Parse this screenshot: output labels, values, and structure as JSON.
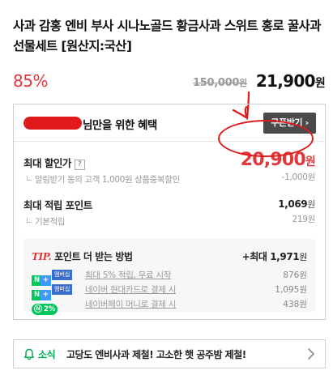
{
  "product": {
    "title": "사과 감홍 엔비 부사 시나노골드 황금사과 스위트 홍로 꿀사과 선물세트 [원산지:국산]"
  },
  "price": {
    "discount_rate": "85%",
    "original": "150,000",
    "original_unit": "원",
    "sale": "21,900",
    "sale_unit": "원"
  },
  "benefit": {
    "header_suffix": "님만을 위한 혜택",
    "coupon_button": "쿠폰받기",
    "max_discount_label": "최대 할인가",
    "max_discount_price": "20,900",
    "max_discount_unit": "원",
    "alarm_note": "알림받기 동의 고객 1,000원 상품중복할인",
    "alarm_amount": "-1,000원",
    "points_label": "최대 적립 포인트",
    "points_value": "1,069",
    "points_unit": "원",
    "basic_label": "기본적립",
    "basic_value": "219원"
  },
  "tip": {
    "tag": "TIP.",
    "title": "포인트 더 받는 방법",
    "max_prefix": "+최대",
    "max_value": "1,971",
    "max_unit": "원",
    "items": [
      {
        "badge_n": "N",
        "badge_plus": "+",
        "badge_mem": "멤버십",
        "text": "최대 5% 적립, 무료 시작",
        "amount": "876원"
      },
      {
        "badge_n": "N",
        "badge_plus": "+",
        "badge_mem": "멤버십",
        "text": "네이버 현대카드로 결제 시",
        "amount": "1,095원"
      },
      {
        "badge_pay": "2%",
        "badge_pay_icon": "N",
        "text": "네이버페이 머니로 결제 시",
        "amount": "438원"
      }
    ]
  },
  "notice": {
    "tag": "소식",
    "message": "고당도 엔비사과 제철! 고소한 햇 공주밤 제철!"
  },
  "icons": {
    "help": "?",
    "coupon_chevron": "›"
  },
  "colors": {
    "accent_red": "#e0383c",
    "naver_green": "#03c75a",
    "annotation_red": "#e01a1a"
  }
}
